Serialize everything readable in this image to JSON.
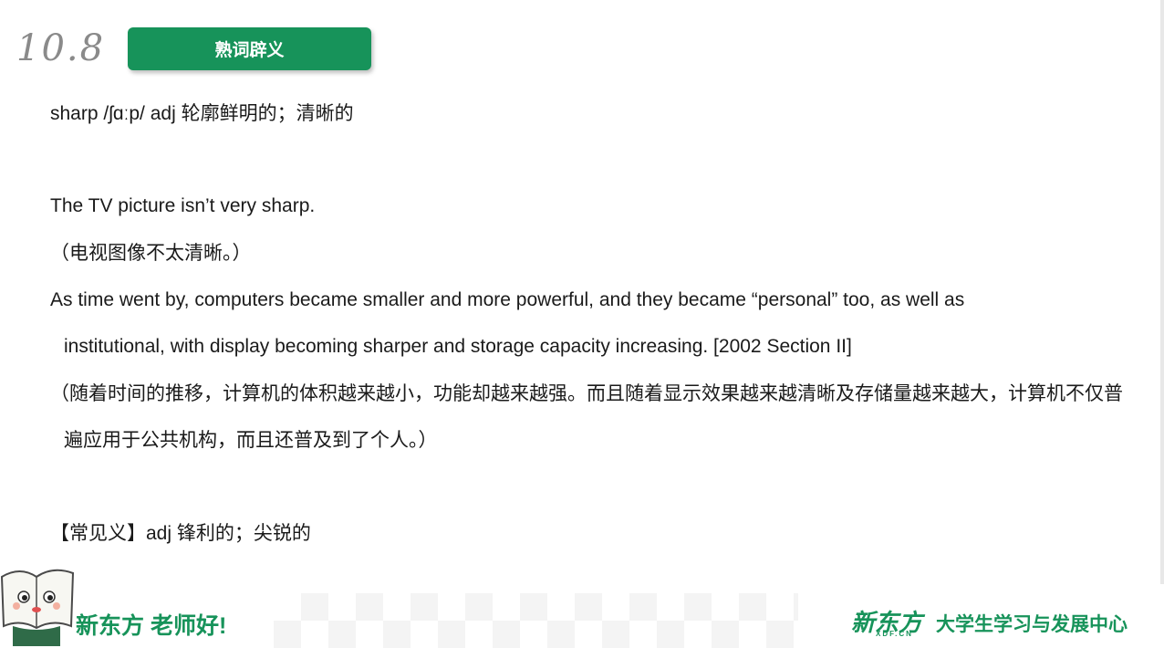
{
  "header": {
    "date": "10.8",
    "title": "熟词辟义"
  },
  "content": {
    "entry": "sharp /ʃɑːp/ adj 轮廓鲜明的；清晰的",
    "example1_en": "The TV picture isn’t very sharp.",
    "example1_zh": "（电视图像不太清晰。）",
    "example2_en_line1": "As time went by, computers became smaller and more powerful, and they became  “personal”  too, as well as",
    "example2_en_line2": "institutional, with display becoming sharper and storage capacity increasing. [2002 Section II]",
    "example2_zh_line1": "（随着时间的推移，计算机的体积越来越小，功能却越来越强。而且随着显示效果越来越清晰及存储量越来越大，计算机不仅普",
    "example2_zh_line2": "遍应用于公共机构，而且还普及到了个人。）",
    "common_meaning": "【常见义】adj 锋利的；尖锐的"
  },
  "footer": {
    "slogan": "新东方 老师好!",
    "logo_text": "新东方",
    "logo_sub": "XDF.CN",
    "center_name": "大学生学习与发展中心",
    "brand_color": "#17935a",
    "mascot_icon": "book-mascot-icon"
  }
}
